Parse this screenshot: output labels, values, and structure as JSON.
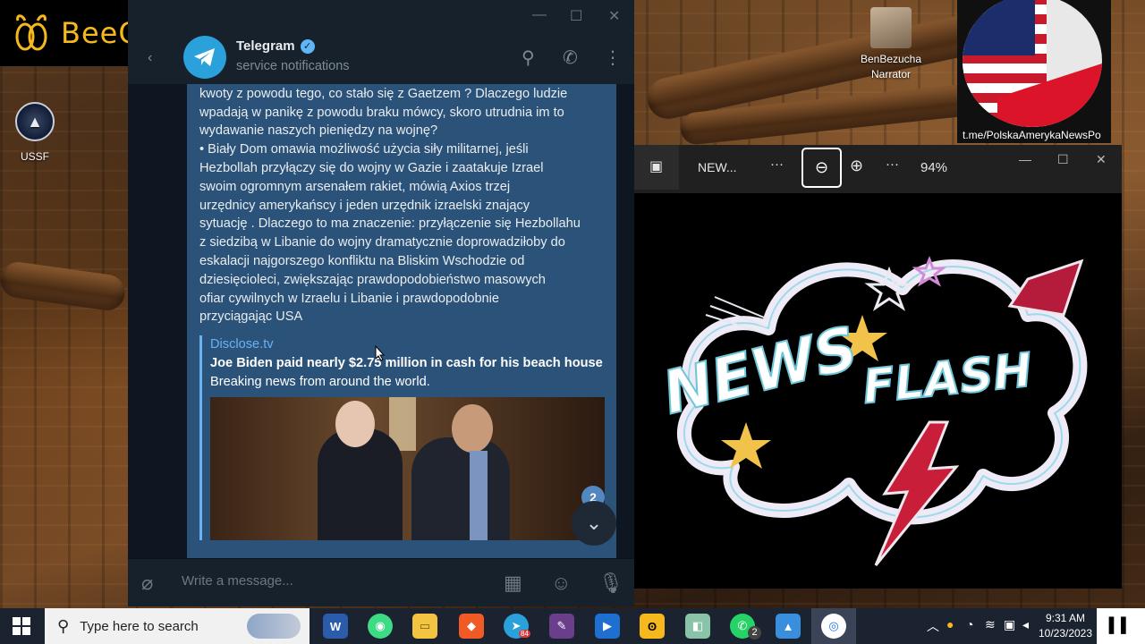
{
  "watermark": {
    "brand": "BeeCut"
  },
  "desktop": {
    "icons": [
      {
        "label": "USSF"
      }
    ],
    "narrator": {
      "line1": "BenBezucha",
      "line2": "Narrator"
    },
    "flag_overlay": {
      "link": "t.me/PolskaAmerykaNewsPo"
    }
  },
  "telegram": {
    "window_title": "Telegram",
    "chat_name": "Telegram",
    "chat_status": "service notifications",
    "message": {
      "text": "ponieważ wyglądu na to, że mają trudności z wysłaniem większej\nkwoty z powodu tego, co stało się z Gaetzem ? Dlaczego ludzie\nwpadają w panikę z powodu braku mówcy, skoro utrudnia im to\nwydawanie naszych pieniędzy na wojnę?\n•  Biały Dom omawia możliwość użycia siły militarnej, jeśli\nHezbollah przyłączy się do wojny w Gazie i zaatakuje Izrael\nswoim ogromnym arsenałem rakiet, mówią Axios trzej\nurzędnicy amerykańscy i jeden urzędnik izraelski znający\nsytuację . Dlaczego to ma znaczenie: przyłączenie się Hezbollahu\nz siedzibą w Libanie do wojny dramatycznie doprowadziłoby do\neskalacji najgorszego konfliktu na Bliskim Wschodzie od\ndziesięcioleci, zwiększając prawdopodobieństwo masowych\nofiar cywilnych w Izraelu i Libanie i prawdopodobnie\nprzyciągając USA",
      "preview": {
        "site": "Disclose.tv",
        "title": "Joe Biden paid nearly $2.75 million in cash for his beach house",
        "description": "Breaking news from around the world."
      }
    },
    "unread_count": "2",
    "compose_placeholder": "Write a message..."
  },
  "photos": {
    "file_tab": "NEW...",
    "zoom": "94%",
    "image_text": {
      "line1": "NEWS",
      "line2": "FLASH"
    }
  },
  "taskbar": {
    "search_placeholder": "Type here to search",
    "whatsapp_badge": "2",
    "telegram_badge": "84",
    "clock_time": "9:31 AM",
    "clock_date": "10/23/2023"
  },
  "colors": {
    "telegram_bg": "#0e1621",
    "bubble": "#2b5278",
    "link": "#6ab3f3",
    "beecut_yellow": "#f6b91d"
  }
}
